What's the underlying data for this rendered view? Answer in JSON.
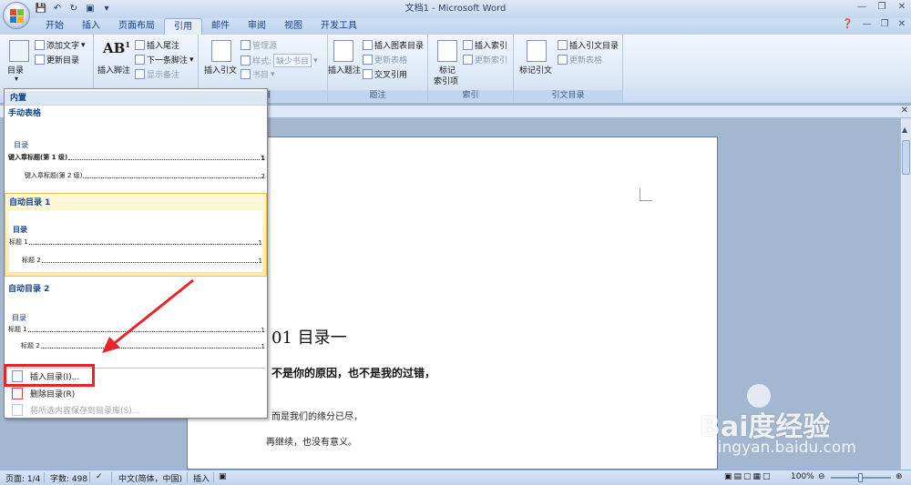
{
  "window": {
    "title": "文档1 - Microsoft Word",
    "qat": [
      "save-icon",
      "undo-icon",
      "redo-icon",
      "print-preview-icon",
      "dropdown-icon"
    ]
  },
  "tabs": [
    "开始",
    "插入",
    "页面布局",
    "引用",
    "邮件",
    "审阅",
    "视图",
    "开发工具"
  ],
  "active_tab": "引用",
  "ribbon": {
    "toc_group": {
      "toc_button": "目录",
      "add_text": "添加文字",
      "update_toc": "更新目录"
    },
    "footnote_group": {
      "insert_footnote": "插入脚注",
      "insert_endnote": "插入尾注",
      "next_footnote": "下一条脚注",
      "show_notes": "显示备注",
      "ab_glyph": "AB",
      "ab_sup": "1"
    },
    "citation_group": {
      "insert_citation": "插入引文",
      "manage_sources": "管理源",
      "style_label": "样式:",
      "style_value": "缺少书目",
      "bibliography": "书目",
      "label": "书目"
    },
    "caption_group": {
      "insert_caption": "插入题注",
      "insert_table_of_figures": "插入图表目录",
      "update_table": "更新表格",
      "cross_reference": "交叉引用",
      "label": "题注"
    },
    "index_group": {
      "mark_entry": "标记",
      "mark_entry_2": "索引项",
      "insert_index": "插入索引",
      "update_index": "更新索引",
      "label": "索引"
    },
    "toa_group": {
      "mark_citation": "标记引文",
      "insert_toa": "插入引文目录",
      "update_table": "更新表格",
      "label": "引文目录"
    }
  },
  "menu": {
    "builtin_header": "内置",
    "manual_header": "手动表格",
    "manual_preview": {
      "title": "目录",
      "lines": [
        {
          "text": "键入章标题(第 1 级)",
          "page": "1",
          "level": 1
        },
        {
          "text": "键入章标题(第 2 级)",
          "page": "2",
          "level": 2
        }
      ]
    },
    "auto1_header": "自动目录 1",
    "auto1_preview": {
      "title": "目录",
      "lines": [
        {
          "text": "标题 1",
          "page": "1",
          "level": 1
        },
        {
          "text": "标题 2",
          "page": "1",
          "level": 2
        }
      ]
    },
    "auto2_header": "自动目录 2",
    "auto2_preview": {
      "title": "目录",
      "lines": [
        {
          "text": "标题 1",
          "page": "1",
          "level": 1
        },
        {
          "text": "标题 2",
          "page": "1",
          "level": 2
        }
      ]
    },
    "insert_toc": "插入目录(I)...",
    "remove_toc": "删除目录(R)",
    "save_selection": "将所选内容保存到目录库(S)..."
  },
  "document": {
    "heading": "01 目录一",
    "line1": "不是你的原因，也不是我的过错，",
    "line2": "而是我们的缘分已尽，",
    "line3": "再继续，也没有意义。"
  },
  "statusbar": {
    "page": "页面: 1/4",
    "words": "字数: 498",
    "language": "中文(简体，中国)",
    "insert_mode": "插入",
    "zoom": "100%"
  },
  "watermark": {
    "brand": "Bai度经验",
    "url": "jingyan.baidu.com"
  },
  "colors": {
    "accent_red": "#e8242b",
    "ribbon_blue": "#15428b"
  }
}
